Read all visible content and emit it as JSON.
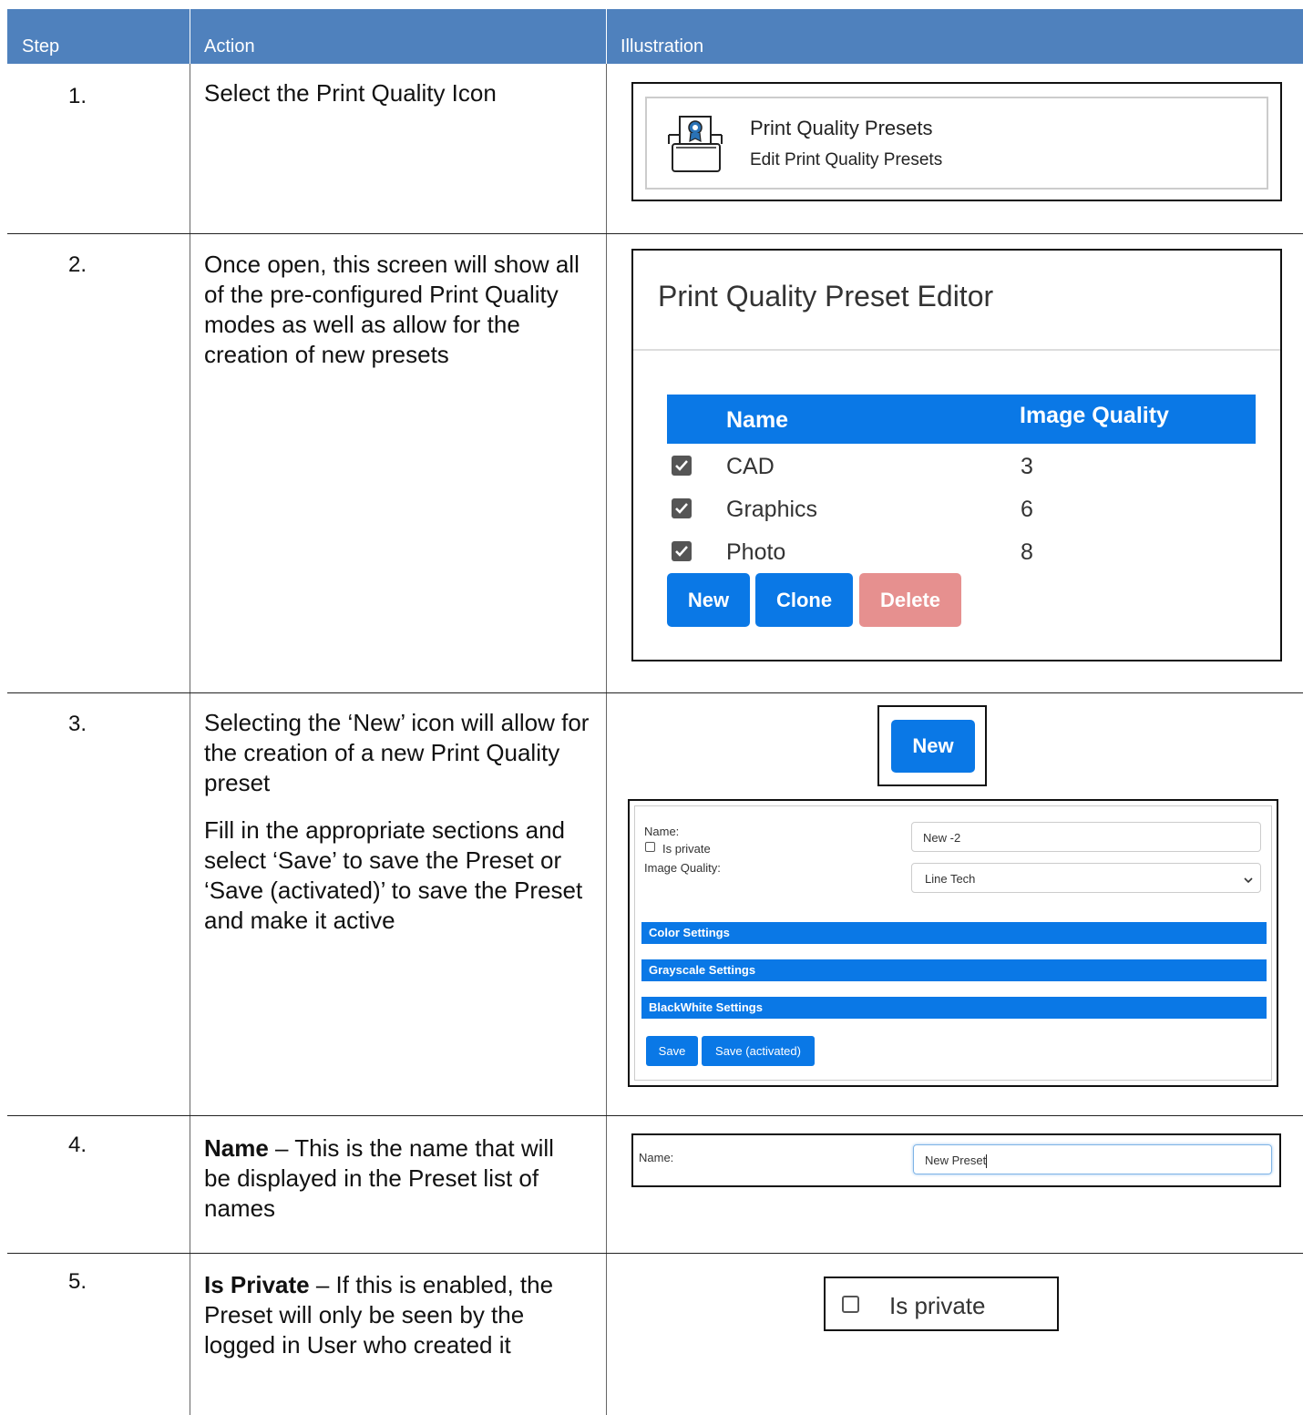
{
  "header": {
    "step": "Step",
    "action": "Action",
    "illustration": "Illustration"
  },
  "rows": [
    {
      "num": "1.",
      "text": "Select the Print Quality Icon"
    },
    {
      "num": "2.",
      "text": "Once open, this screen will show all of the pre-configured Print Quality modes as well as allow for the creation of new presets"
    },
    {
      "num": "3.",
      "text1": "Selecting the ‘New’ icon will allow for the creation of a new Print Quality preset",
      "text2": "Fill in the appropriate sections and select ‘Save’ to save the Preset or ‘Save (activated)’ to save the Preset and make it active"
    },
    {
      "num": "4.",
      "bold": "Name",
      "text": " – This is the name that will be displayed in the Preset list of names"
    },
    {
      "num": "5.",
      "bold": "Is Private",
      "text": " – If this is enabled, the Preset will only be seen by the logged in User who created it"
    }
  ],
  "ill1": {
    "title": "Print Quality Presets",
    "subtitle": "Edit Print Quality Presets",
    "icon": "print-quality-icon"
  },
  "ill2": {
    "title": "Print Quality Preset Editor",
    "col_name": "Name",
    "col_quality": "Image Quality",
    "presets": [
      {
        "name": "CAD",
        "quality": "3"
      },
      {
        "name": "Graphics",
        "quality": "6"
      },
      {
        "name": "Photo",
        "quality": "8"
      }
    ],
    "btn_new": "New",
    "btn_clone": "Clone",
    "btn_delete": "Delete"
  },
  "ill3": {
    "new_button": "New",
    "name_label": "Name:",
    "name_value": "New -2",
    "private_label": "Is private",
    "quality_label": "Image Quality:",
    "quality_value": "Line Tech",
    "sections": [
      "Color Settings",
      "Grayscale Settings",
      "BlackWhite Settings"
    ],
    "save": "Save",
    "save_activated": "Save (activated)"
  },
  "ill4": {
    "name_label": "Name:",
    "name_value": "New Preset"
  },
  "ill5": {
    "private_label": "Is private"
  },
  "colors": {
    "header": "#4f81bd",
    "button_blue": "#0a78e6",
    "delete_disabled": "#e6908f"
  }
}
